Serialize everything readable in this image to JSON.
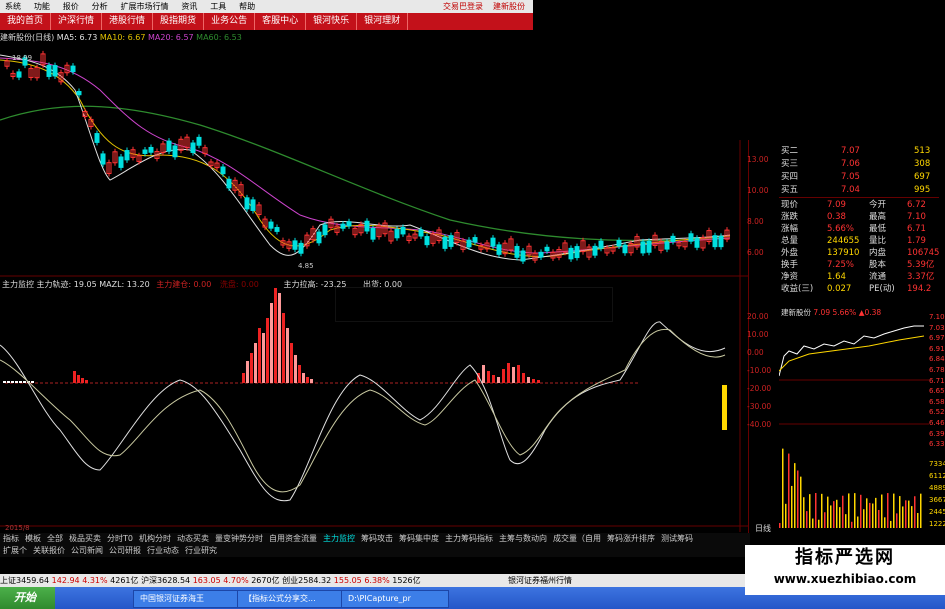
{
  "menu": {
    "items": [
      "系统",
      "功能",
      "报价",
      "分析",
      "扩展市场行情",
      "资讯",
      "工具",
      "帮助"
    ],
    "right_items": [
      "交易巴登录",
      "建新股份"
    ]
  },
  "nav": {
    "tabs": [
      "我的首页",
      "沪深行情",
      "港股行情",
      "股指期货",
      "业务公告",
      "客服中心",
      "银河快乐",
      "银河理财"
    ]
  },
  "title": {
    "stock": "建新股份(日线)",
    "ma5": "MA5: 6.73",
    "ma10": "MA10: 6.67",
    "ma20": "MA20: 6.57",
    "ma60": "MA60: 6.53",
    "high_label": "18.99",
    "low_label": "4.85"
  },
  "indicator": {
    "line1": "主力监控  主力轨迹: 19.05  MAZL: 13.20",
    "zlsk": "主力建仓: 0.00",
    "xh": "洗盘: 0.00",
    "lajia": "主力拉高: -23.25",
    "chuhuo": "出货: 0.00"
  },
  "quote": {
    "rows": [
      {
        "label": "买二",
        "price": "7.07",
        "vol": "513"
      },
      {
        "label": "买三",
        "price": "7.06",
        "vol": "308"
      },
      {
        "label": "买四",
        "price": "7.05",
        "vol": "697"
      },
      {
        "label": "买五",
        "price": "7.04",
        "vol": "995"
      }
    ],
    "stats": [
      {
        "k1": "现价",
        "v1": "7.09",
        "k2": "今开",
        "v2": "6.72"
      },
      {
        "k1": "涨跌",
        "v1": "0.38",
        "k2": "最高",
        "v2": "7.10"
      },
      {
        "k1": "涨幅",
        "v1": "5.66%",
        "k2": "最低",
        "v2": "6.71"
      },
      {
        "k1": "总量",
        "v1": "244655",
        "k2": "量比",
        "v2": "1.79"
      },
      {
        "k1": "外盘",
        "v1": "137910",
        "k2": "内盘",
        "v2": "106745"
      },
      {
        "k1": "换手",
        "v1": "7.25%",
        "k2": "股本",
        "v2": "5.39亿"
      },
      {
        "k1": "净资",
        "v1": "1.64",
        "k2": "流通",
        "v2": "3.37亿"
      },
      {
        "k1": "收益(三)",
        "v1": "0.027",
        "k2": "PE(动)",
        "v2": "194.2"
      }
    ],
    "mini_title": "建新股份",
    "mini_price": "7.09",
    "mini_pct": "5.66%",
    "mini_chg": "▲0.38",
    "mini_ticks": [
      "7.10",
      "7.03",
      "6.97",
      "6.91",
      "6.84",
      "6.78",
      "6.71",
      "6.65",
      "6.58",
      "6.52",
      "6.46",
      "6.39",
      "6.33"
    ],
    "vol_ticks": [
      "7334",
      "6112",
      "4889",
      "3667",
      "2445",
      "1222"
    ],
    "right_axis_top": [
      "13.00",
      "10.00",
      "8.00",
      "6.00"
    ],
    "right_axis_ind": [
      "20.00",
      "10.00",
      "0.00",
      "-10.00",
      "-20.00",
      "-30.00",
      "-40.00"
    ],
    "bottom_label": "日线"
  },
  "tabs": [
    "指标",
    "模板",
    "全部",
    "极品买卖",
    "分时T0",
    "机构分时",
    "动态买卖",
    "量变钟势分时",
    "自用资金流量",
    "主力监控",
    "筹码攻击",
    "筹码集中度",
    "主力筹码指标",
    "主筹与数动向",
    "成交量（自用",
    "筹码涨升排序",
    "测试筹码"
  ],
  "tabs_active": "主力监控",
  "tabs2": [
    "扩展个",
    "关联报价",
    "公司新闻",
    "公司研报",
    "行业动态",
    "行业研究"
  ],
  "status": {
    "sh": "上证3459.64",
    "sh_chg": "142.94",
    "sh_pct": "4.31%",
    "sh_amt": "4261亿",
    "sz": "沪深3628.54",
    "sz_chg": "163.05",
    "sz_pct": "4.70%",
    "sz_amt": "2670亿",
    "cy": "创业2584.32",
    "cy_chg": "155.05",
    "cy_pct": "6.38%",
    "cy_amt": "1526亿",
    "right": "银河证券福州行情"
  },
  "taskbar": {
    "start": "开始",
    "items": [
      "中国银河证券海王",
      "【指标公式分享交...",
      "D:\\PICapture_pr"
    ]
  },
  "watermark": {
    "line1": "指标严选网",
    "line2": "www.xuezhibiao.com"
  },
  "colors": {
    "up": "#ff3333",
    "down": "#00e0e0",
    "ma5": "#e0e0e0",
    "ma10": "#e0c000",
    "ma20": "#cc44cc",
    "ma60": "#2e8b2e",
    "nav": "#c3111a"
  }
}
